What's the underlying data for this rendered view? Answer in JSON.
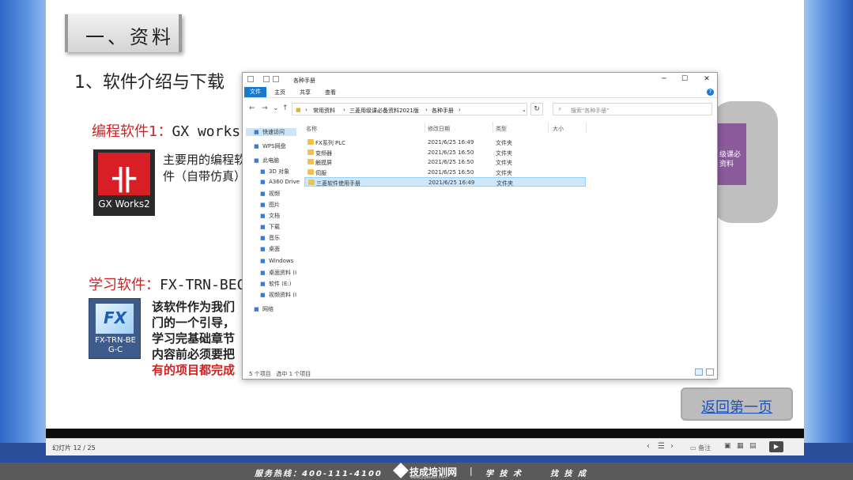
{
  "slide": {
    "title": "一、资料",
    "section_heading": "1、软件介绍与下载",
    "software1": {
      "heading_red": "编程软件1：",
      "heading_name": "GX works",
      "icon_label": "GX Works2",
      "desc_line1": "主要用的编程软",
      "desc_line2": "件（自带仿真）"
    },
    "software2": {
      "heading_red": "学习软件：",
      "heading_name": "FX-TRN-BEC",
      "icon_label_line1": "FX-TRN-BE",
      "icon_label_line2": "G-C",
      "desc_line1": "该软件作为我们",
      "desc_line2": "门的一个引导，",
      "desc_line3": "学习完基础章节",
      "desc_line4": "内容前必须要把",
      "desc_line5_red": "有的项目都完成"
    },
    "folder_thumb_text": "级课必\n资料",
    "back_button": "返回第一页"
  },
  "explorer": {
    "title": "各种手册",
    "ribbon_tabs": [
      "文件",
      "主页",
      "共享",
      "查看"
    ],
    "breadcrumbs": [
      "常用资料",
      "三菱用级课必备资料2021版",
      "各种手册"
    ],
    "search_placeholder": "搜索\"各种手册\"",
    "nav_items": [
      {
        "label": "快速访问",
        "icon": "star-icon"
      },
      {
        "label": "WPS网盘",
        "icon": "cloud-icon"
      },
      {
        "label": "此电脑",
        "icon": "computer-icon"
      },
      {
        "label": "3D 对象",
        "icon": "cube-icon"
      },
      {
        "label": "A360 Drive",
        "icon": "cloud-drive-icon"
      },
      {
        "label": "视频",
        "icon": "video-icon"
      },
      {
        "label": "图片",
        "icon": "picture-icon"
      },
      {
        "label": "文档",
        "icon": "document-icon"
      },
      {
        "label": "下载",
        "icon": "download-icon"
      },
      {
        "label": "音乐",
        "icon": "music-icon"
      },
      {
        "label": "桌面",
        "icon": "desktop-icon"
      },
      {
        "label": "Windows",
        "icon": "drive-icon"
      },
      {
        "label": "桌面资料 (I",
        "icon": "drive-icon"
      },
      {
        "label": "软件 (E:)",
        "icon": "drive-icon"
      },
      {
        "label": "视频资料 (I",
        "icon": "drive-icon"
      },
      {
        "label": "网络",
        "icon": "network-icon"
      }
    ],
    "columns": [
      "名称",
      "修改日期",
      "类型",
      "大小"
    ],
    "files": [
      {
        "name": "FX系列 PLC",
        "date": "2021/6/25 16:49",
        "type": "文件夹"
      },
      {
        "name": "变频器",
        "date": "2021/6/25 16:50",
        "type": "文件夹"
      },
      {
        "name": "触摸屏",
        "date": "2021/6/25 16:50",
        "type": "文件夹"
      },
      {
        "name": "伺服",
        "date": "2021/6/25 16:50",
        "type": "文件夹"
      },
      {
        "name": "三菱软件使用手册",
        "date": "2021/6/25 16:49",
        "type": "文件夹"
      }
    ],
    "status_count": "5 个项目",
    "status_selected": "选中 1 个项目"
  },
  "ppt_status": {
    "slide_count": "幻灯片 12 / 25",
    "notes_label": "备注"
  },
  "banner": {
    "hotline": "服务热线：400-111-4100",
    "brand": "技成培训网",
    "url": "www.jcpeixun.com",
    "slogan1": "学 技 术",
    "slogan2": "找 技 成"
  }
}
